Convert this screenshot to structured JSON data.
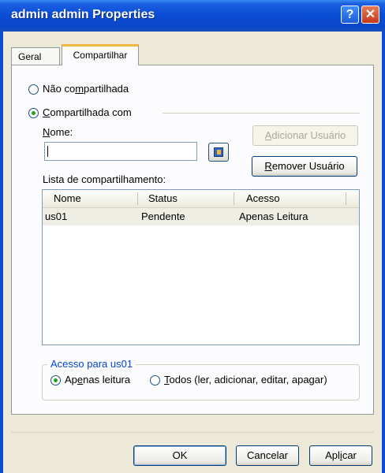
{
  "window": {
    "title": "admin admin Properties",
    "help": "?",
    "close": "✕"
  },
  "tabs": [
    {
      "label": "Geral"
    },
    {
      "label": "Compartilhar",
      "active": true
    }
  ],
  "sharing": {
    "not_shared_label_a": "Não co",
    "not_shared_label_u": "m",
    "not_shared_label_b": "partilhada",
    "shared_with_u": "C",
    "shared_with_rest": "ompartilhada com",
    "name_label_u": "N",
    "name_label_rest": "ome:",
    "name_value": "",
    "add_user_u": "A",
    "add_user_rest": "dicionar Usuário",
    "remove_user_u": "R",
    "remove_user_rest": "emover Usuário",
    "list_label": "Lista de compartilhamento:",
    "columns": [
      "Nome",
      "Status",
      "Acesso"
    ],
    "rows": [
      {
        "name": "us01",
        "status": "Pendente",
        "access": "Apenas Leitura"
      }
    ],
    "selected": "not_shared_false"
  },
  "access": {
    "legend": "Acesso para us01",
    "read_only_a": "Ap",
    "read_only_u": "e",
    "read_only_b": "nas leitura",
    "all_u": "T",
    "all_rest": "odos (ler, adicionar, editar, apagar)"
  },
  "footer": {
    "ok": "OK",
    "cancel": "Cancelar",
    "apply_a": "Apl",
    "apply_u": "i",
    "apply_b": "car"
  },
  "colors": {
    "title_bar": "#0a4cd6",
    "dialog_bg": "#ece9d8",
    "tab_highlight": "#f3b73e",
    "legend": "#0046d5"
  }
}
